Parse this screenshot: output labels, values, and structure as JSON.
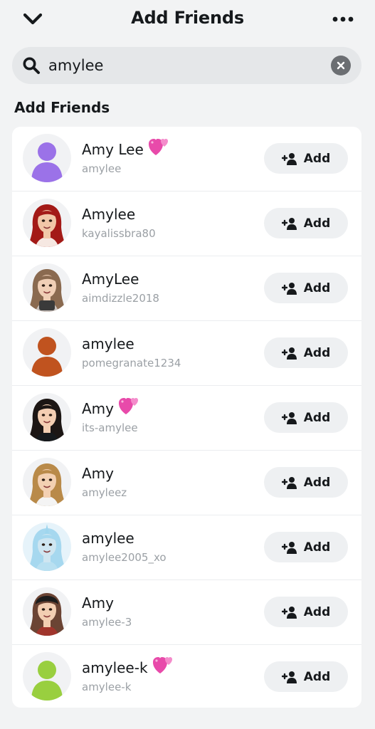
{
  "header": {
    "title": "Add Friends"
  },
  "search": {
    "value": "amylee"
  },
  "section": {
    "title": "Add Friends"
  },
  "add_label": "Add",
  "results": [
    {
      "name": "Amy Lee",
      "username": "amylee",
      "heart": true,
      "avatar": "purple-silhouette"
    },
    {
      "name": "Amylee",
      "username": "kayalissbra80",
      "heart": false,
      "avatar": "bitmoji-red-curly-hair"
    },
    {
      "name": "AmyLee",
      "username": "aimdizzle2018",
      "heart": false,
      "avatar": "bitmoji-brown-hair-phone"
    },
    {
      "name": "amylee",
      "username": "pomegranate1234",
      "heart": false,
      "avatar": "orange-silhouette"
    },
    {
      "name": "Amy",
      "username": "its-amylee",
      "heart": true,
      "avatar": "bitmoji-black-hair"
    },
    {
      "name": "Amy",
      "username": "amyleez",
      "heart": false,
      "avatar": "bitmoji-blonde-hair"
    },
    {
      "name": "amylee",
      "username": "amylee2005_xo",
      "heart": false,
      "avatar": "bitmoji-blue-unicorn"
    },
    {
      "name": "Amy",
      "username": "amylee-3",
      "heart": false,
      "avatar": "bitmoji-backwards-cap"
    },
    {
      "name": "amylee-k",
      "username": "amylee-k",
      "heart": true,
      "avatar": "green-silhouette"
    }
  ]
}
